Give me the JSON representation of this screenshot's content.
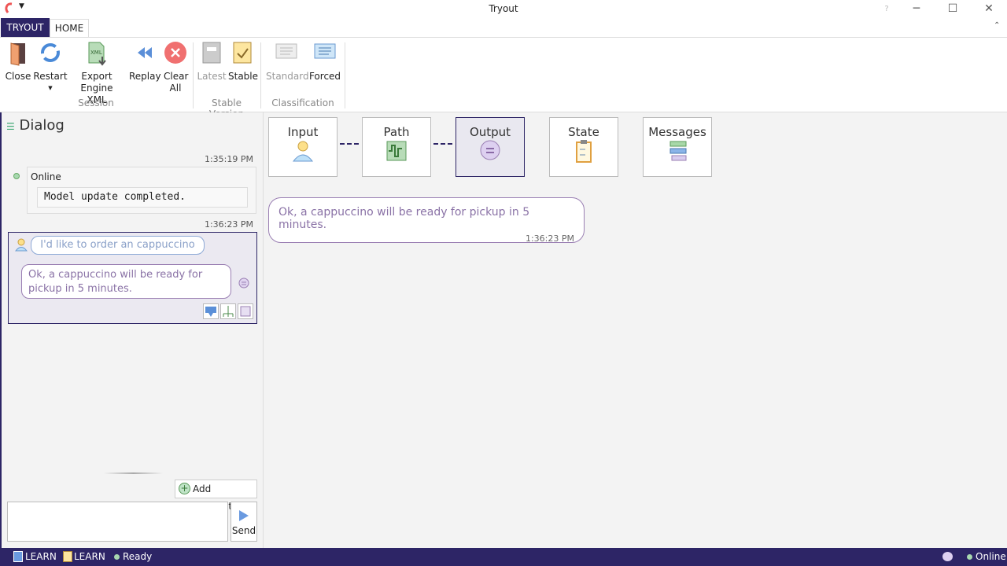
{
  "window": {
    "title": "Tryout",
    "help": "?"
  },
  "tabs": [
    {
      "label": "TRYOUT"
    },
    {
      "label": "HOME"
    }
  ],
  "ribbon": {
    "session": {
      "label": "Session",
      "buttons": [
        {
          "label": "Close",
          "icon": "door-icon"
        },
        {
          "label": "Restart",
          "icon": "refresh-icon"
        },
        {
          "label": "Export Engine XML",
          "icon": "xml-export-icon"
        },
        {
          "label": "Replay",
          "icon": "rewind-icon"
        },
        {
          "label": "Clear All",
          "icon": "clear-icon"
        }
      ]
    },
    "stable_version": {
      "label": "Stable Version",
      "buttons": [
        {
          "label": "Latest",
          "disabled": true
        },
        {
          "label": "Stable",
          "disabled": false
        }
      ]
    },
    "classification": {
      "label": "Classification",
      "buttons": [
        {
          "label": "Standard",
          "disabled": true
        },
        {
          "label": "Forced",
          "disabled": false
        }
      ]
    }
  },
  "dialog": {
    "title": "Dialog",
    "entries": [
      {
        "time": "1:35:19 PM",
        "status": "Online",
        "message": "Model update completed."
      },
      {
        "time": "1:36:23 PM",
        "input": "I'd like to order an cappuccino",
        "output": "Ok, a cappuccino will be ready for pickup in 5 minutes."
      }
    ],
    "add_parameter": "Add Parameter",
    "input_value": "",
    "send": "Send"
  },
  "steps": [
    {
      "label": "Input"
    },
    {
      "label": "Path"
    },
    {
      "label": "Output",
      "selected": true
    },
    {
      "label": "State"
    },
    {
      "label": "Messages"
    }
  ],
  "output": {
    "text": "Ok, a cappuccino will be ready for pickup in 5 minutes.",
    "time": "1:36:23 PM"
  },
  "statusbar": {
    "learn1": "LEARN",
    "learn2": "LEARN",
    "ready": "Ready",
    "online": "Online"
  },
  "colors": {
    "accent": "#2d2566",
    "online": "#8fc79a"
  }
}
